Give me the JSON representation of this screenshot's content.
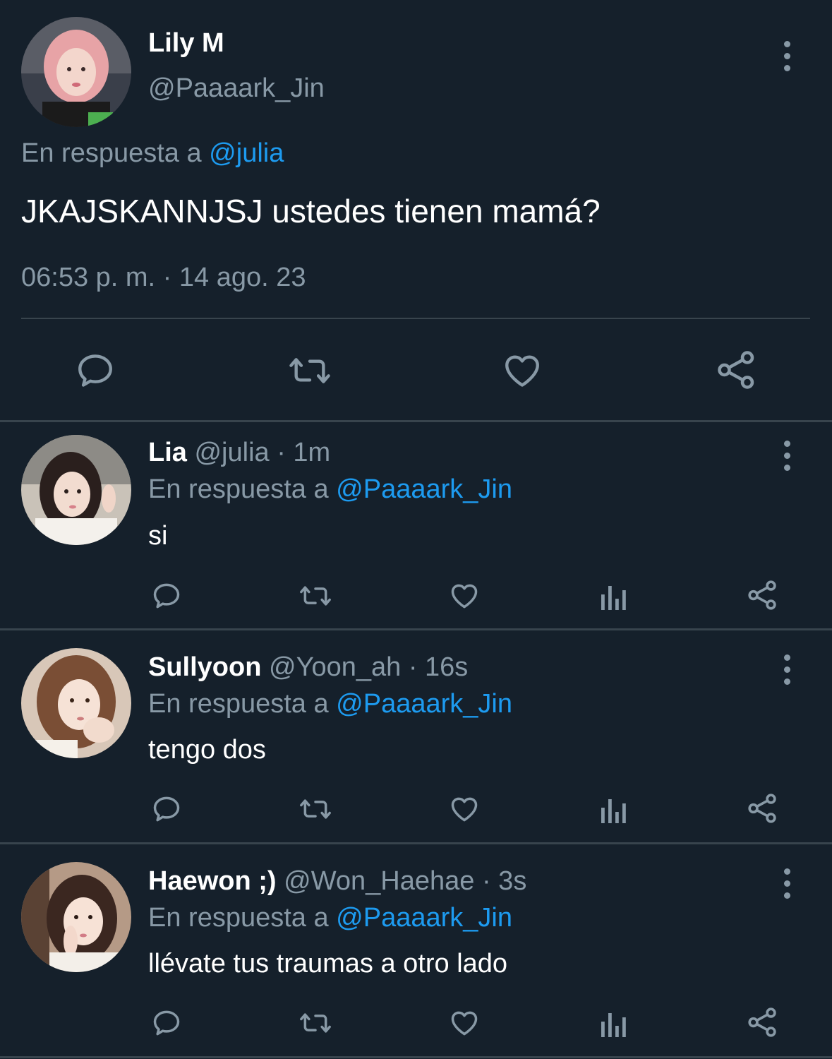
{
  "main_tweet": {
    "display_name": "Lily M",
    "handle": "@Paaaark_Jin",
    "reply_prefix": "En respuesta a",
    "reply_to": "@julia",
    "text": "JKAJSKANNJSJ ustedes tienen mamá?",
    "timestamp": "06:53 p. m. · 14 ago. 23",
    "actions": [
      "reply-icon",
      "retweet-icon",
      "like-icon",
      "share-icon"
    ]
  },
  "replies": [
    {
      "display_name": "Lia",
      "handle": "@julia",
      "time": "· 1m",
      "reply_prefix": "En respuesta a",
      "reply_to": "@Paaaark_Jin",
      "text": "si"
    },
    {
      "display_name": "Sullyoon",
      "handle": "@Yoon_ah",
      "time": "· 16s",
      "reply_prefix": "En respuesta a",
      "reply_to": "@Paaaark_Jin",
      "text": "tengo dos"
    },
    {
      "display_name": "Haewon ;)",
      "handle": "@Won_Haehae",
      "time": "· 3s",
      "reply_prefix": "En respuesta a",
      "reply_to": "@Paaaark_Jin",
      "text": "llévate tus traumas a otro lado"
    }
  ],
  "colors": {
    "background": "#15202b",
    "muted": "#8899a6",
    "link": "#1d9bf0",
    "divider": "#38444d"
  }
}
